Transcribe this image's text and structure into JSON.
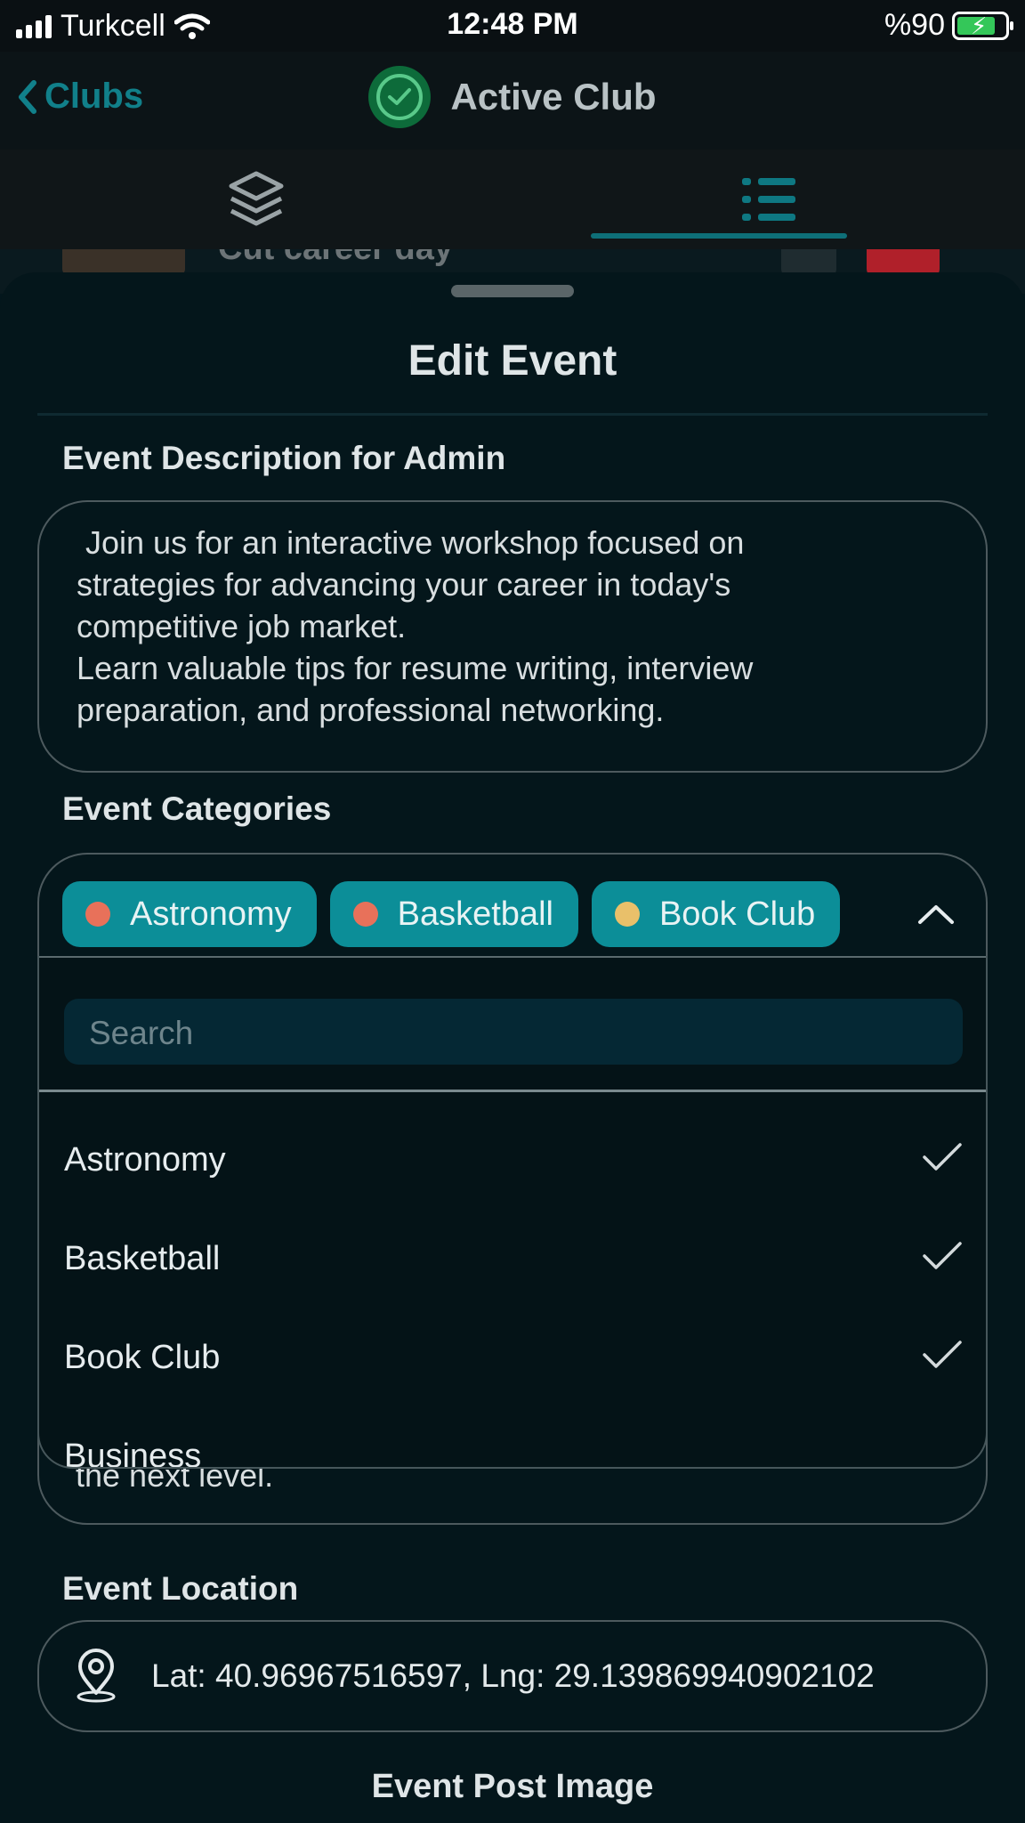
{
  "status_bar": {
    "carrier": "Turkcell",
    "time": "12:48 PM",
    "battery": "%90"
  },
  "nav": {
    "back_label": "Clubs",
    "title": "Active Club"
  },
  "tabs": [
    {
      "icon": "layers-icon"
    },
    {
      "icon": "list-icon"
    }
  ],
  "peek_row": {
    "title": "Cut career day"
  },
  "sheet": {
    "title": "Edit Event",
    "description_label": "Event Description for Admin",
    "description_value": " Join us for an interactive workshop focused on\nstrategies for advancing your career in today's\ncompetitive job market.\nLearn valuable tips for resume writing, interview\npreparation, and professional networking.",
    "categories_label": "Event Categories",
    "selected_chips": [
      {
        "label": "Astronomy",
        "dot_color": "#e8715a"
      },
      {
        "label": "Basketball",
        "dot_color": "#e8715a"
      },
      {
        "label": "Book Club",
        "dot_color": "#e9c06a"
      }
    ],
    "search_placeholder": "Search",
    "options": [
      {
        "label": "Astronomy",
        "checked": true
      },
      {
        "label": "Basketball",
        "checked": true
      },
      {
        "label": "Book Club",
        "checked": true
      },
      {
        "label": "Business",
        "checked": false
      }
    ],
    "hidden_text_tail": "the next level.",
    "location_label": "Event Location",
    "location_value": "Lat: 40.96967516597, Lng: 29.139869940902102",
    "post_image_label": "Event Post Image"
  },
  "colors": {
    "accent": "#0c8e98",
    "background": "#04161b",
    "delete_red": "#b0202a"
  }
}
